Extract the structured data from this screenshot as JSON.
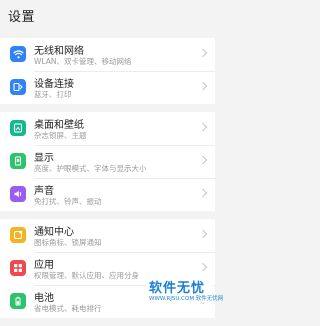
{
  "header": {
    "title": "设置"
  },
  "rows": [
    {
      "title": "无线和网络",
      "subtitle": "WLAN、双卡管理、移动网络",
      "icon": "wifi-icon",
      "color": "#2f83f7"
    },
    {
      "title": "设备连接",
      "subtitle": "蓝牙、打印",
      "icon": "device-connection-icon",
      "color": "#2f83f7"
    },
    {
      "title": "桌面和壁纸",
      "subtitle": "杂志锁屏、主题",
      "icon": "wallpaper-icon",
      "color": "#13b98d"
    },
    {
      "title": "显示",
      "subtitle": "亮度、护眼模式、字体与显示大小",
      "icon": "display-icon",
      "color": "#2bc36b"
    },
    {
      "title": "声音",
      "subtitle": "免打扰、铃声、振动",
      "icon": "sound-icon",
      "color": "#9b5cf0"
    },
    {
      "title": "通知中心",
      "subtitle": "图标角标、锁屏通知",
      "icon": "notification-icon",
      "color": "#f3b323"
    },
    {
      "title": "应用",
      "subtitle": "权限管理、默认应用、应用分身",
      "icon": "apps-icon",
      "color": "#f2484d"
    },
    {
      "title": "电池",
      "subtitle": "省电模式、耗电排行",
      "icon": "battery-icon",
      "color": "#2bc36b"
    }
  ],
  "watermark": {
    "main": "软件无忧",
    "sub": "WWW.RJ5U.COM 软件无忧网"
  }
}
